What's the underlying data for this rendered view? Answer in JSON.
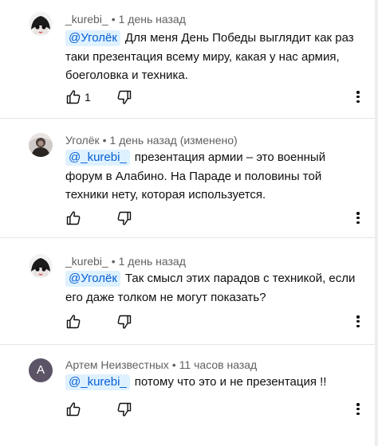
{
  "comments": [
    {
      "author": "_kurebi_",
      "separator": "•",
      "time": "1 день назад",
      "mention": "@Уголёк",
      "text": "Для меня День Победы выглядит как раз таки презентация всему миру, какая у нас армия, боеголовка и техника.",
      "like_count": "1"
    },
    {
      "author": "Уголёк",
      "separator": "•",
      "time": "1 день назад (изменено)",
      "mention": "@_kurebi_",
      "text": "презентация армии – это военный форум в Алабино. На Параде и половины той техники нету, которая используется.",
      "like_count": ""
    },
    {
      "author": "_kurebi_",
      "separator": "•",
      "time": "1 день назад",
      "mention": "@Уголёк",
      "text": "Так смысл этих парадов с техникой, если его даже толком не могут показать?",
      "like_count": ""
    },
    {
      "author": "Артем Неизвестных",
      "avatar_letter": "А",
      "separator": "•",
      "time": "11 часов назад",
      "mention": "@_kurebi_",
      "text": "потому что это и не презентация !!",
      "like_count": ""
    }
  ],
  "icons": {
    "like": "thumbs-up-outline-icon",
    "dislike": "thumbs-down-outline-icon",
    "more": "vertical-ellipsis-icon"
  },
  "colors": {
    "mention_text": "#065fd4",
    "mention_background": "#def1ff",
    "meta_text": "#606060",
    "avatar_letter_background": "#5c5466",
    "divider": "#e5e5e5"
  }
}
